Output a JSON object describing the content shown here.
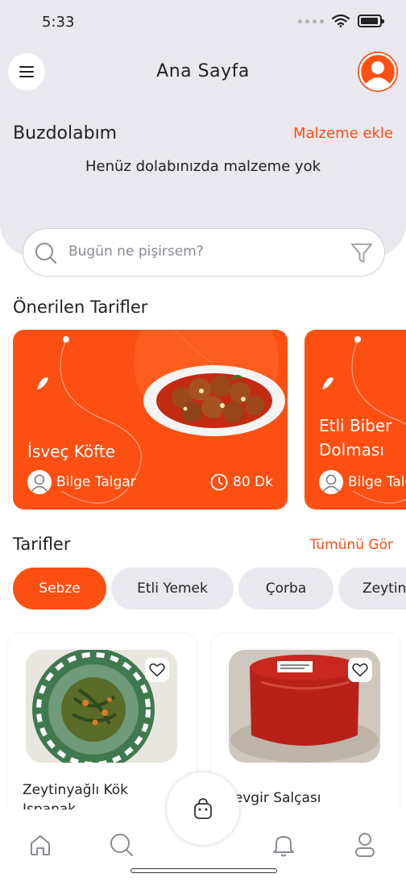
{
  "status_bar": {
    "time": "5:33"
  },
  "header": {
    "title": "Ana Sayfa"
  },
  "fridge": {
    "title": "Buzdolabım",
    "add_label": "Malzeme ekle",
    "empty_message": "Henüz dolabınızda malzeme yok"
  },
  "search": {
    "placeholder": "Bugün ne pişirsem?"
  },
  "recommended": {
    "title": "Önerilen Tarifler",
    "cards": [
      {
        "name": "İsveç Köfte",
        "author": "Bilge Talgar",
        "time": "80 Dk"
      },
      {
        "name": "Etli Biber Dolması",
        "author": "Bilge Talgar",
        "time": ""
      }
    ]
  },
  "recipes": {
    "title": "Tarifler",
    "see_all": "Tümünü Gör",
    "categories": [
      {
        "label": "Sebze",
        "active": true
      },
      {
        "label": "Etli Yemek",
        "active": false
      },
      {
        "label": "Çorba",
        "active": false
      },
      {
        "label": "Zeytinyağlı",
        "active": false
      }
    ],
    "items": [
      {
        "name": "Zeytinyağlı Kök Ispanak"
      },
      {
        "name": "Sevgir Salçası"
      }
    ]
  },
  "bottom_nav": {
    "items": [
      "home-icon",
      "search-icon",
      "basket-icon",
      "bell-icon",
      "user-icon"
    ]
  },
  "colors": {
    "accent": "#fb5012",
    "header_bg": "#e8e8ee",
    "chip_bg": "#e8e8ee"
  }
}
